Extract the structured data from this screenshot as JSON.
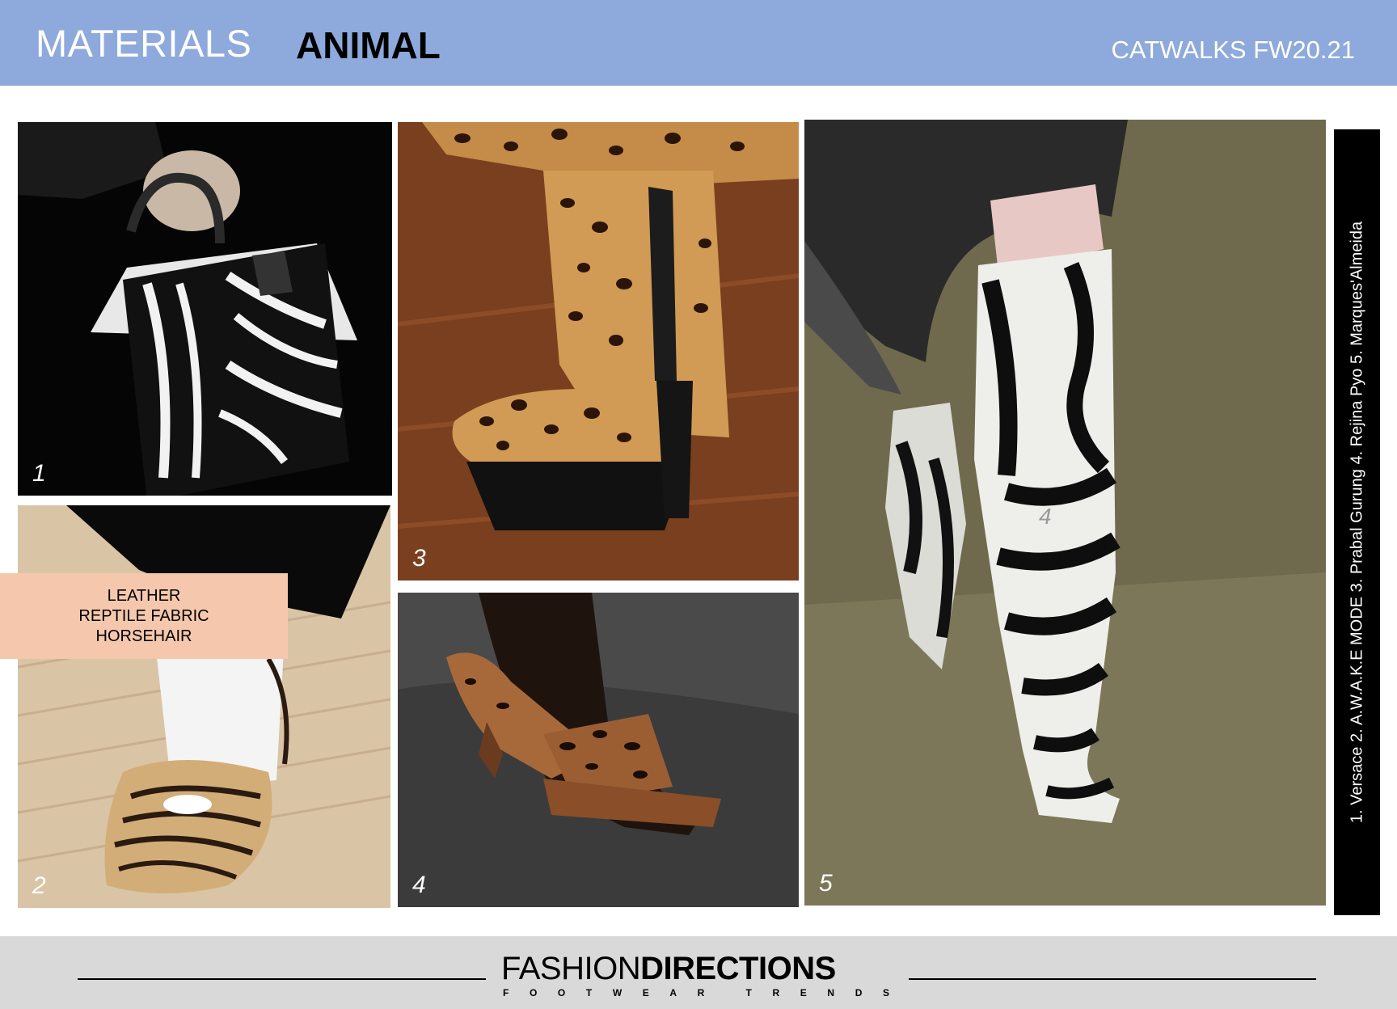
{
  "header": {
    "section": "MATERIALS",
    "theme": "ANIMAL",
    "season": "CATWALKS FW20.21"
  },
  "photos": [
    {
      "number": "1",
      "subject": "zebra print handbag"
    },
    {
      "number": "2",
      "subject": "zebra print pump"
    },
    {
      "number": "3",
      "subject": "leopard platform boot"
    },
    {
      "number": "4",
      "subject": "leopard sculpted heel mule"
    },
    {
      "number": "5",
      "subject": "zebra pony hair knee boot"
    }
  ],
  "photo5_faint_mark": "4",
  "materials_box": {
    "lines": [
      "LEATHER",
      "REPTILE FABRIC",
      "HORSEHAIR"
    ]
  },
  "credits": "1. Versace  2. A.W.A.K.E MODE  3. Prabal Gurung  4. Rejina Pyo  5. Marques'Almeida",
  "footer": {
    "brand_light": "FASHION",
    "brand_bold": "DIRECTIONS",
    "tagline_letters": [
      "F",
      "O",
      "O",
      "T",
      "W",
      "E",
      "A",
      "R",
      "",
      "T",
      "R",
      "E",
      "N",
      "D",
      "S"
    ]
  },
  "colors": {
    "header_bg": "#8ea9db",
    "materials_box_bg": "#f5c8ad",
    "footer_bg": "#d9d9d9",
    "credits_bar_bg": "#000000"
  }
}
